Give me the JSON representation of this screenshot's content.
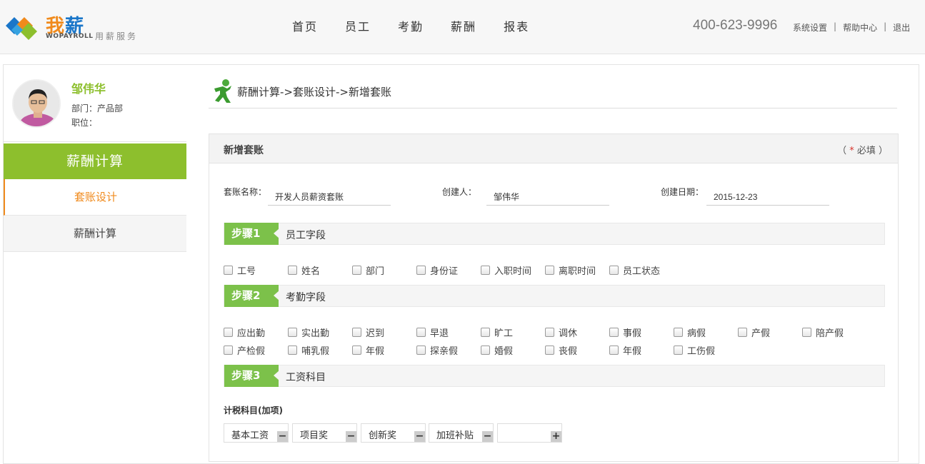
{
  "brand": {
    "name_cn_orange": "我",
    "name_cn_blue": "薪",
    "name_en": "WOPAYROLL",
    "slogan": "用薪服务"
  },
  "nav": [
    "首页",
    "员工",
    "考勤",
    "薪酬",
    "报表"
  ],
  "hotline": "400-623-9996",
  "toplinks": {
    "settings": "系统设置",
    "help": "帮助中心",
    "logout": "退出",
    "separator": "|"
  },
  "user": {
    "name": "邹伟华",
    "dept": "部门：产品部",
    "position": "职位："
  },
  "sidebar": {
    "title": "薪酬计算",
    "items": [
      "套账设计",
      "薪酬计算"
    ]
  },
  "breadcrumb": "薪酬计算->套账设计->新增套账",
  "panel": {
    "title": "新增套账",
    "required_prefix": "（ ",
    "required_star": "*",
    "required_text": " 必填 ）"
  },
  "form": {
    "name_label": "套账名称：",
    "name_value": "开发人员薪资套账",
    "creator_label": "创建人：",
    "creator_value": "邹伟华",
    "date_label": "创建日期：",
    "date_value": "2015-12-23"
  },
  "steps": [
    {
      "tag": "步骤1",
      "name": "员工字段"
    },
    {
      "tag": "步骤2",
      "name": "考勤字段"
    },
    {
      "tag": "步骤3",
      "name": "工资科目"
    }
  ],
  "employee_fields": [
    "工号",
    "姓名",
    "部门",
    "身份证",
    "入职时间",
    "离职时间",
    "员工状态"
  ],
  "attendance_fields_row1": [
    "应出勤",
    "实出勤",
    "迟到",
    "早退",
    "旷工",
    "调休",
    "事假",
    "病假",
    "产假",
    "陪产假"
  ],
  "attendance_fields_row2": [
    "产检假",
    "哺乳假",
    "年假",
    "探亲假",
    "婚假",
    "丧假",
    "年假",
    "工伤假"
  ],
  "salary": {
    "subhead": "计税科目(加项)",
    "items": [
      "基本工资",
      "项目奖",
      "创新奖",
      "加班补贴"
    ],
    "remove_symbol": "−",
    "add_symbol": "+"
  },
  "colors": {
    "green": "#8dbf2d",
    "step_green": "#7cc14a",
    "orange": "#f08a1c",
    "blue": "#1a76c9"
  }
}
